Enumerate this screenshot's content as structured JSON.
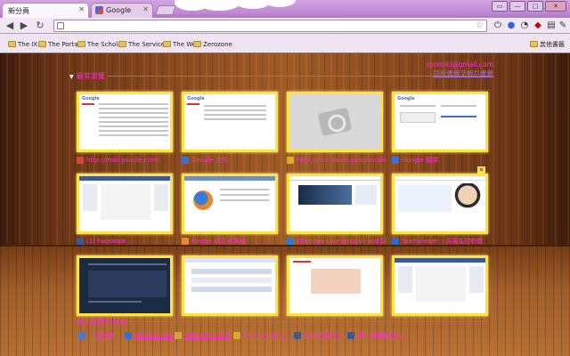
{
  "tabs": [
    {
      "label": "新分頁",
      "active": true
    },
    {
      "label": "Google",
      "active": false
    }
  ],
  "toolbar": {
    "url_value": "",
    "back": "◀",
    "forward": "▶",
    "reload": "↻",
    "star": "☆"
  },
  "window_controls": [
    "▭",
    "—",
    "▢",
    "✕"
  ],
  "bookmarks": [
    {
      "label": "The IX"
    },
    {
      "label": "The Portal"
    },
    {
      "label": "The Scholar"
    },
    {
      "label": "The Services"
    },
    {
      "label": "The Web"
    },
    {
      "label": "Zerozone"
    }
  ],
  "other_bookmarks": "其他書籤",
  "most_visited": {
    "heading": "最常瀏覽",
    "account_email": "spomikl@gmail.com",
    "account_sub": "同步書籤至帳戶書籤",
    "items": [
      {
        "label": "http://mail.google.com/",
        "color": "#d54a3b"
      },
      {
        "label": "Google 文件",
        "color": "#3b6fd6"
      },
      {
        "label": "http://picasaweb.google.com/",
        "color": "#e0a82e"
      },
      {
        "label": "Google 翻譯",
        "color": "#3b6fd6"
      },
      {
        "label": "(1) Facebook",
        "color": "#3b5998"
      },
      {
        "label": "Firefox 網頁瀏覽器",
        "color": "#e6892b"
      },
      {
        "label": "Windows Live Hotmail and Skydrive",
        "color": "#2b7bd6"
      },
      {
        "label": "TeamViewer - 遠端遙控軟體",
        "color": "#2b6ad6"
      },
      {
        "label": "",
        "color": "#556"
      },
      {
        "label": "",
        "color": "#556"
      },
      {
        "label": "",
        "color": "#556"
      },
      {
        "label": "",
        "color": "#556"
      }
    ]
  },
  "recently_closed": {
    "heading": "最近關閉的分頁",
    "items": [
      {
        "label": "1 個分頁",
        "color": "#4a7ad6"
      },
      {
        "label": "Stratos Rodde",
        "color": "#3b6fd6"
      },
      {
        "label": "window_contr",
        "color": "#d5a23b"
      },
      {
        "label": "Chrome 線上",
        "color": "#e0a82e"
      },
      {
        "label": "好人的自尊心",
        "color": "#3b5998"
      },
      {
        "label": "黑人輔輔班玩文",
        "color": "#3b5998"
      }
    ]
  }
}
